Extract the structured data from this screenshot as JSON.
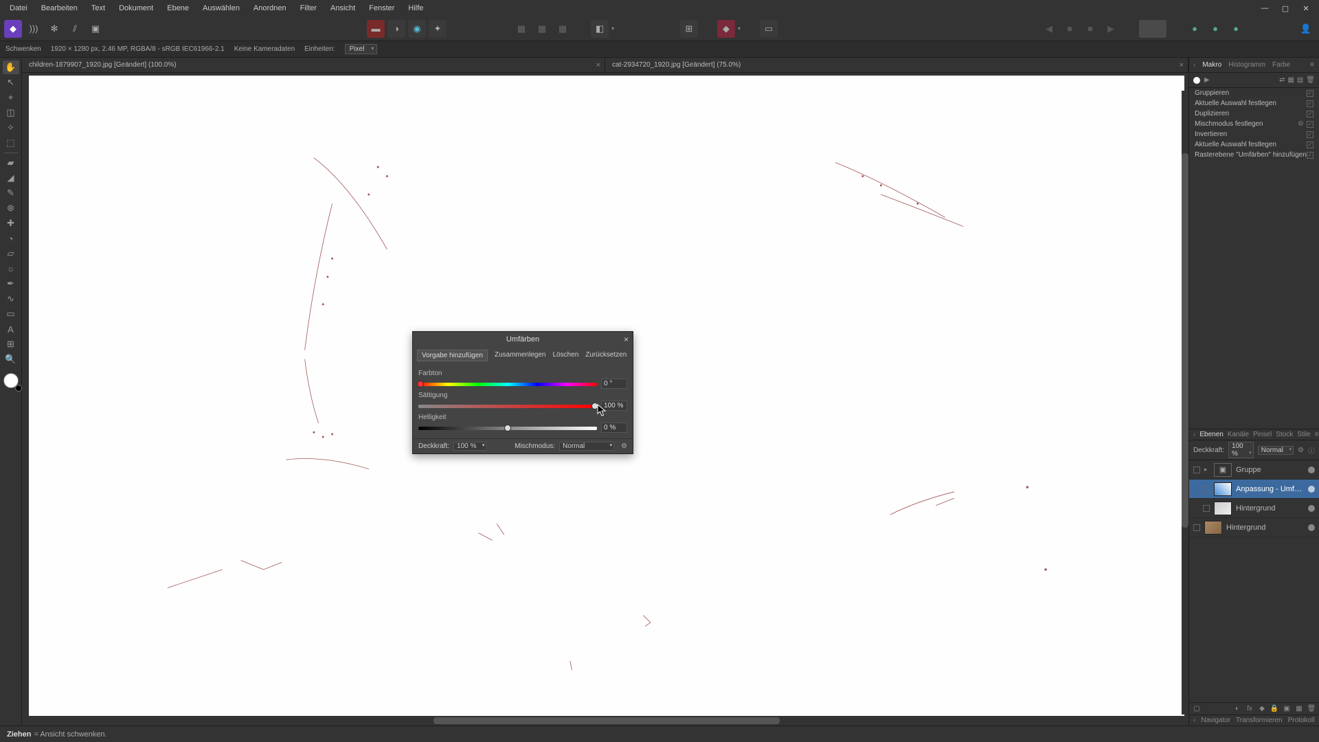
{
  "menubar": [
    "Datei",
    "Bearbeiten",
    "Text",
    "Dokument",
    "Ebene",
    "Auswählen",
    "Anordnen",
    "Filter",
    "Ansicht",
    "Fenster",
    "Hilfe"
  ],
  "context": {
    "tool": "Schwenken",
    "docinfo": "1920 × 1280 px, 2.46 MP, RGBA/8 - sRGB IEC61966-2.1",
    "camera": "Keine Kameradaten",
    "units_label": "Einheiten:",
    "units_value": "Pixel"
  },
  "tabs": [
    {
      "label": "children-1879907_1920.jpg [Geändert] (100.0%)"
    },
    {
      "label": "cat-2934720_1920.jpg [Geändert] (75.0%)"
    }
  ],
  "right_top_tabs": [
    "Makro",
    "Histogramm",
    "Farbe"
  ],
  "macro_items": [
    {
      "label": "Gruppieren",
      "check": true
    },
    {
      "label": "Aktuelle Auswahl festlegen",
      "check": true
    },
    {
      "label": "Duplizieren",
      "check": true
    },
    {
      "label": "Mischmodus festlegen",
      "gear": true
    },
    {
      "label": "Invertieren",
      "check": true
    },
    {
      "label": "Aktuelle Auswahl festlegen",
      "check": true
    },
    {
      "label": "Rasterebene \"Umfärben\" hinzufügen",
      "check": true
    }
  ],
  "layer_tabs": [
    "Ebenen",
    "Kanäle",
    "Pinsel",
    "Stock",
    "Stile"
  ],
  "layer_opts": {
    "opacity_label": "Deckkraft:",
    "opacity": "100 %",
    "blend": "Normal"
  },
  "layers": [
    {
      "name": "Gruppe",
      "type": "group",
      "sel": false
    },
    {
      "name": "Anpassung - Umfärben",
      "type": "adj",
      "sel": true,
      "indent": true
    },
    {
      "name": "Hintergrund",
      "type": "pix",
      "sel": false,
      "indent": true
    },
    {
      "name": "Hintergrund",
      "type": "pix2",
      "sel": false
    }
  ],
  "nav_tabs": [
    "Navigator",
    "Transformieren",
    "Protokoll"
  ],
  "status": {
    "action": "Ziehen",
    "hint": "= Ansicht schwenken."
  },
  "dialog": {
    "title": "Umfärben",
    "buttons": {
      "add": "Vorgabe hinzufügen",
      "merge": "Zusammenlegen",
      "del": "Löschen",
      "reset": "Zurücksetzen"
    },
    "hue_label": "Farbton",
    "hue_val": "0 °",
    "sat_label": "Sättigung",
    "sat_val": "100 %",
    "light_label": "Helligkeit",
    "light_val": "0 %",
    "opacity_label": "Deckkraft:",
    "opacity_val": "100 %",
    "blend_label": "Mischmodus:",
    "blend_val": "Normal"
  }
}
